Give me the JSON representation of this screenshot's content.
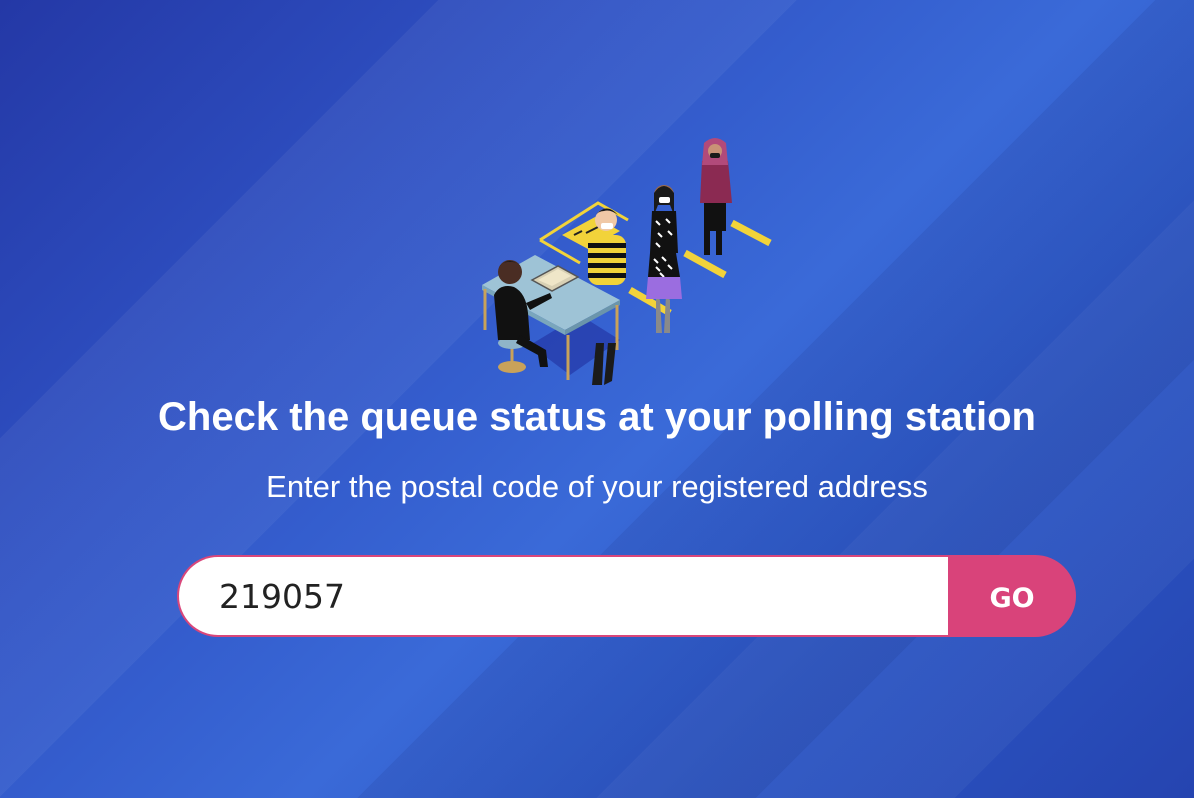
{
  "page": {
    "title": "Check the queue status at your polling station",
    "subtitle": "Enter the postal code of your registered address"
  },
  "search": {
    "value": "219057",
    "placeholder": "",
    "go_label": "GO"
  },
  "illustration": {
    "icon": "polling-station-queue-illustration"
  },
  "colors": {
    "background": "#2f52c4",
    "accent": "#d9437a",
    "text": "#ffffff"
  }
}
